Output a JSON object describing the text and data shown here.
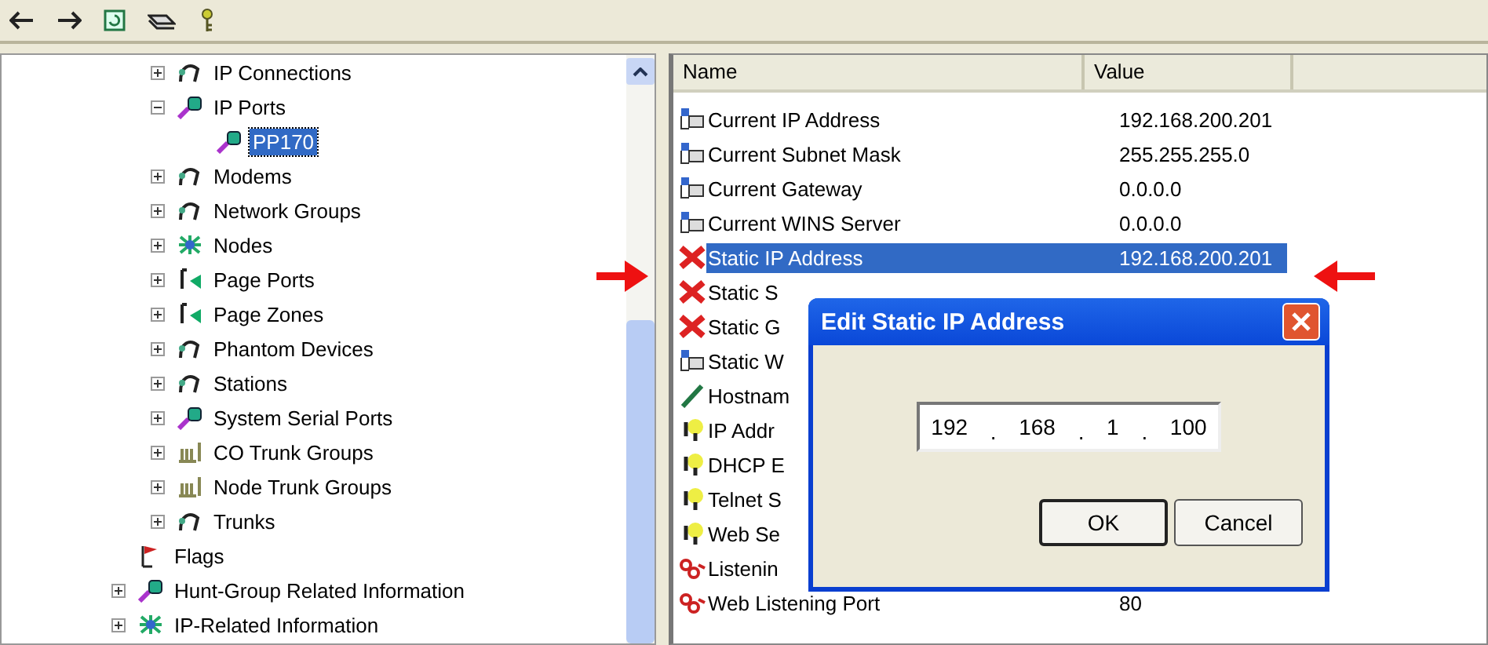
{
  "toolbar": {
    "buttons": [
      {
        "kind": "back"
      },
      {
        "kind": "forward"
      },
      {
        "kind": "refresh"
      },
      {
        "kind": "stack"
      },
      {
        "kind": "key"
      }
    ]
  },
  "tree": [
    {
      "children": [
        {
          "label": "IP Connections",
          "kind": "device",
          "expanded": false,
          "selected": false
        },
        {
          "label": "IP Ports",
          "kind": "plug",
          "expanded": true,
          "selected": false,
          "children": [
            {
              "label": "PP170",
              "kind": "plug",
              "selected": true
            }
          ]
        },
        {
          "label": "Modems",
          "kind": "device",
          "expanded": false,
          "selected": false
        },
        {
          "label": "Network Groups",
          "kind": "device",
          "expanded": false,
          "selected": false
        },
        {
          "label": "Nodes",
          "kind": "node",
          "expanded": false,
          "selected": false
        },
        {
          "label": "Page Ports",
          "kind": "page",
          "expanded": false,
          "selected": false
        },
        {
          "label": "Page Zones",
          "kind": "page",
          "expanded": false,
          "selected": false
        },
        {
          "label": "Phantom Devices",
          "kind": "device",
          "expanded": false,
          "selected": false
        },
        {
          "label": "Stations",
          "kind": "device",
          "expanded": false,
          "selected": false
        },
        {
          "label": "System Serial Ports",
          "kind": "plug",
          "expanded": false,
          "selected": false
        },
        {
          "label": "CO Trunk Groups",
          "kind": "trunks",
          "expanded": false,
          "selected": false
        },
        {
          "label": "Node Trunk Groups",
          "kind": "trunks",
          "expanded": false,
          "selected": false
        },
        {
          "label": "Trunks",
          "kind": "device",
          "expanded": false,
          "selected": false
        }
      ]
    },
    {
      "label": "Flags",
      "kind": "flag",
      "selected": false
    },
    {
      "label": "Hunt-Group Related Information",
      "kind": "plug",
      "expanded": false,
      "selected": false
    },
    {
      "label": "IP-Related Information",
      "kind": "node",
      "expanded": false,
      "selected": false
    }
  ],
  "table": {
    "columns": [
      "Name",
      "Value"
    ],
    "rows": [
      {
        "name": "Current IP Address",
        "value": "192.168.200.201",
        "kind": "network",
        "selected": false
      },
      {
        "name": "Current Subnet Mask",
        "value": "255.255.255.0",
        "kind": "network",
        "selected": false
      },
      {
        "name": "Current Gateway",
        "value": "0.0.0.0",
        "kind": "network",
        "selected": false
      },
      {
        "name": "Current WINS Server",
        "value": "0.0.0.0",
        "kind": "network",
        "selected": false
      },
      {
        "name": "Static IP Address",
        "value": "192.168.200.201",
        "kind": "error",
        "selected": true
      },
      {
        "name": "Static S",
        "kind": "error",
        "selected": false
      },
      {
        "name": "Static G",
        "kind": "error",
        "selected": false
      },
      {
        "name": "Static W",
        "kind": "network",
        "selected": false
      },
      {
        "name": "Hostnam",
        "kind": "pen",
        "selected": false
      },
      {
        "name": "IP Addr",
        "kind": "bulb",
        "selected": false
      },
      {
        "name": "DHCP E",
        "kind": "bulb",
        "selected": false
      },
      {
        "name": "Telnet S",
        "kind": "bulb",
        "selected": false
      },
      {
        "name": "Web Se",
        "kind": "bulb",
        "selected": false
      },
      {
        "name": "Listenin",
        "kind": "listen",
        "selected": false
      },
      {
        "name": "Web Listening Port",
        "value": "80",
        "kind": "listen",
        "selected": false
      }
    ]
  },
  "dialog": {
    "title": "Edit Static IP Address",
    "octets": [
      "192",
      "168",
      "1",
      "100"
    ],
    "separator": ".",
    "buttons": [
      {
        "label": "OK",
        "default": true
      },
      {
        "label": "Cancel",
        "default": false
      }
    ]
  }
}
